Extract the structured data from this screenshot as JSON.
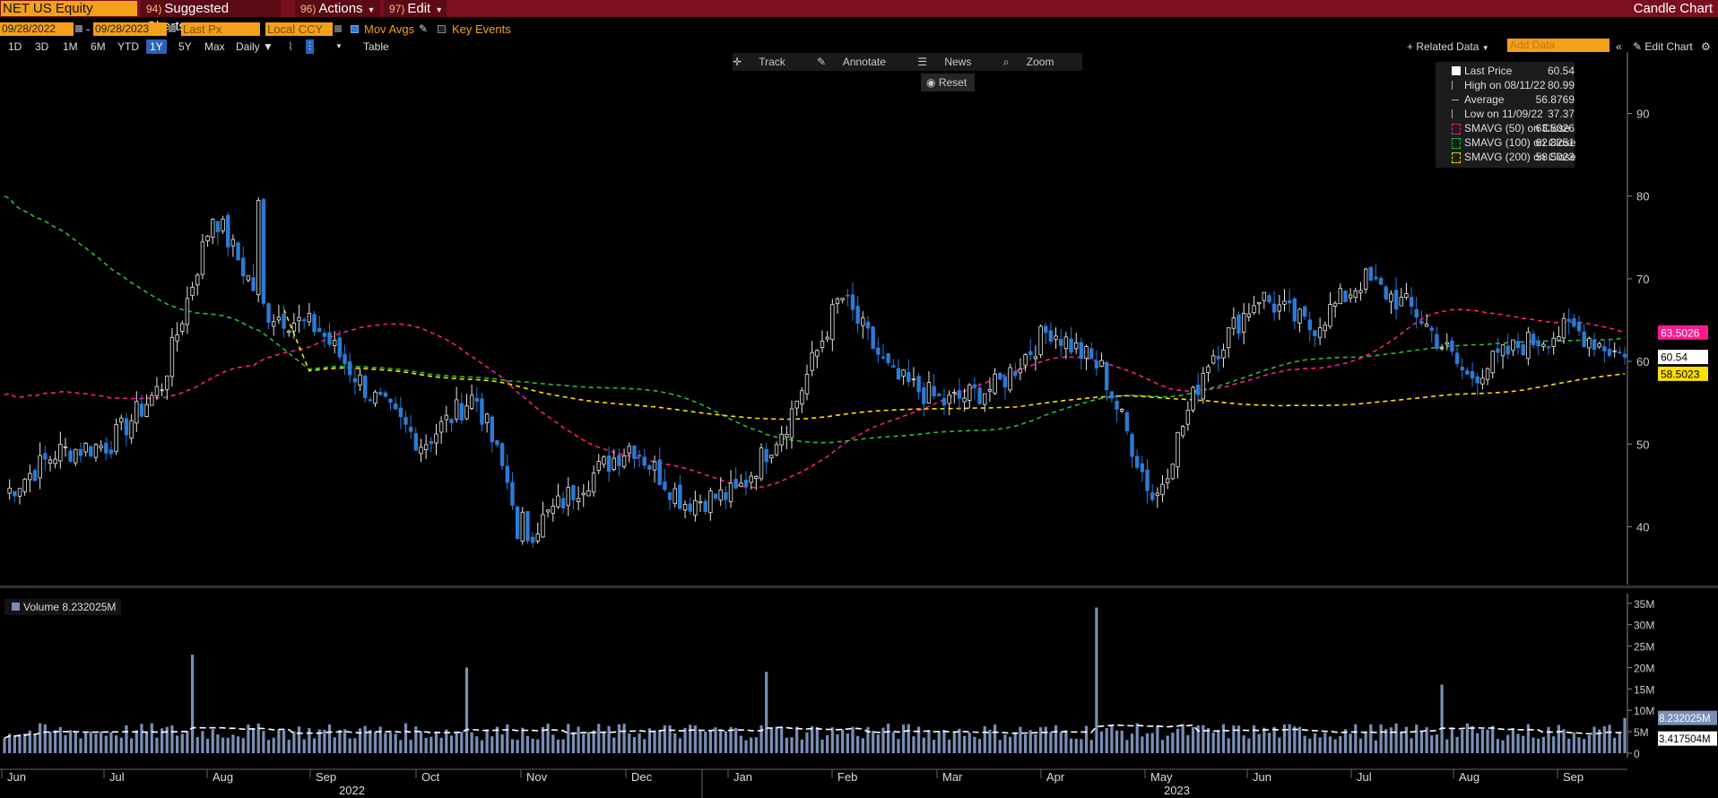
{
  "topbar": {
    "security": "NET US Equity",
    "menus": [
      {
        "num": "94)",
        "label": "Suggested Charts"
      },
      {
        "num": "96)",
        "label": "Actions"
      },
      {
        "num": "97)",
        "label": "Edit"
      }
    ],
    "window_title": "Candle Chart"
  },
  "controls": {
    "start_date": "09/28/2022",
    "date_separator": "-",
    "end_date": "09/28/2023",
    "field": "Last Px",
    "currency": "Local CCY",
    "mov_avgs_label": "Mov Avgs",
    "key_events_label": "Key Events"
  },
  "periods": {
    "items": [
      "1D",
      "3D",
      "1M",
      "6M",
      "YTD",
      "1Y",
      "5Y",
      "Max"
    ],
    "selected": "1Y",
    "frequency": "Daily",
    "table_label": "Table"
  },
  "right_tools": {
    "related_data": "+ Related Data",
    "add_data_placeholder": "Add Data",
    "edit_chart": "Edit Chart"
  },
  "plot_tools": {
    "track": "Track",
    "annotate": "Annotate",
    "news": "News",
    "zoom": "Zoom",
    "reset": "Reset"
  },
  "legend": {
    "rows": [
      {
        "name": "Last Price",
        "value": "60.54",
        "color": "#ffffff"
      },
      {
        "name": "High on 08/11/22",
        "value": "80.99",
        "color": "#aaaaaa"
      },
      {
        "name": "Average",
        "value": "56.8769",
        "color": "#aaaaaa"
      },
      {
        "name": "Low on 11/09/22",
        "value": "37.37",
        "color": "#aaaaaa"
      },
      {
        "name": "SMAVG (50)  on Close",
        "value": "63.5026",
        "color": "#ff1a8c"
      },
      {
        "name": "SMAVG (100)  on Close",
        "value": "62.8251",
        "color": "#1fbf3a"
      },
      {
        "name": "SMAVG (200)  on Close",
        "value": "58.5023",
        "color": "#ffe000"
      }
    ]
  },
  "volume_legend": {
    "label": "Volume",
    "value": "8.232025M"
  },
  "price_tags": [
    {
      "text": "63.5026",
      "value": 63.5026,
      "bg": "#ff1a8c",
      "fg": "#ffffff"
    },
    {
      "text": "60.54",
      "value": 60.54,
      "bg": "#ffffff",
      "fg": "#000000"
    },
    {
      "text": "58.5023",
      "value": 58.5023,
      "bg": "#ffe000",
      "fg": "#000000"
    }
  ],
  "volume_tags": [
    {
      "text": "8.232025M",
      "value": 8.232,
      "bg": "#7a8fb8",
      "fg": "#ffffff"
    },
    {
      "text": "3.417504M",
      "value": 3.4175,
      "bg": "#ffffff",
      "fg": "#000000"
    }
  ],
  "chart_data": {
    "type": "candlestick",
    "x_months": [
      "Jun",
      "Jul",
      "Aug",
      "Sep",
      "Oct",
      "Nov",
      "Dec",
      "Jan",
      "Feb",
      "Mar",
      "Apr",
      "May",
      "Jun",
      "Jul",
      "Aug",
      "Sep"
    ],
    "x_years": [
      "2022",
      "2023"
    ],
    "price_ylim": [
      33,
      97
    ],
    "price_ticks": [
      40,
      50,
      60,
      70,
      80,
      90
    ],
    "volume_ylim": [
      0,
      36
    ],
    "volume_ticks": [
      "0",
      "5M",
      "10M",
      "15M",
      "20M",
      "25M",
      "30M",
      "35M"
    ],
    "price_anchors": [
      {
        "month": "Jun 2022",
        "value": 44
      },
      {
        "month": "mid Jun 2022",
        "value": 49
      },
      {
        "month": "Jul 2022",
        "value": 50
      },
      {
        "month": "mid Jul 2022",
        "value": 57
      },
      {
        "month": "Aug 2022",
        "value": 78
      },
      {
        "month": "mid Aug 2022",
        "value": 66
      },
      {
        "month": "Sep 2022",
        "value": 64
      },
      {
        "month": "mid Sep 2022",
        "value": 56
      },
      {
        "month": "Oct 2022",
        "value": 50
      },
      {
        "month": "mid Oct 2022",
        "value": 56
      },
      {
        "month": "Nov 2022",
        "value": 39
      },
      {
        "month": "mid Nov 2022",
        "value": 45
      },
      {
        "month": "Dec 2022",
        "value": 50
      },
      {
        "month": "mid Dec 2022",
        "value": 43
      },
      {
        "month": "Jan 2023",
        "value": 44
      },
      {
        "month": "mid Jan 2023",
        "value": 53
      },
      {
        "month": "Feb 2023",
        "value": 68
      },
      {
        "month": "mid Feb 2023",
        "value": 58
      },
      {
        "month": "Mar 2023",
        "value": 55
      },
      {
        "month": "mid Mar 2023",
        "value": 57
      },
      {
        "month": "Apr 2023",
        "value": 64
      },
      {
        "month": "end Apr 2023",
        "value": 59
      },
      {
        "month": "May 2023 (gap)",
        "value": 43
      },
      {
        "month": "mid May 2023",
        "value": 60
      },
      {
        "month": "Jun 2023",
        "value": 68
      },
      {
        "month": "mid Jun 2023",
        "value": 64
      },
      {
        "month": "Jul 2023",
        "value": 70
      },
      {
        "month": "mid Jul 2023",
        "value": 66
      },
      {
        "month": "Aug 2023",
        "value": 58
      },
      {
        "month": "mid Aug 2023",
        "value": 62
      },
      {
        "month": "Sep 2023",
        "value": 64
      },
      {
        "month": "end Sep 2023",
        "value": 60.54
      }
    ],
    "high": {
      "date": "08/11/22",
      "value": 80.99
    },
    "low": {
      "date": "11/09/22",
      "value": 37.37
    },
    "average": 56.8769,
    "last": 60.54,
    "moving_averages": [
      {
        "name": "SMAVG (50)",
        "color": "#ff1a8c",
        "last": 63.5026
      },
      {
        "name": "SMAVG (100)",
        "color": "#1fbf3a",
        "last": 62.8251
      },
      {
        "name": "SMAVG (200)",
        "color": "#ffe000",
        "last": 58.5023
      }
    ],
    "up_color": "#e8e8e8",
    "down_color": "#2a7bd6",
    "volume_color": "#7a8fb8",
    "volume_avg_color": "#ffffff",
    "volume_spikes_M": [
      {
        "month": "Aug 2022",
        "value": 23
      },
      {
        "month": "Nov 2022",
        "value": 20
      },
      {
        "month": "Feb 2023",
        "value": 19
      },
      {
        "month": "May 2023",
        "value": 34
      },
      {
        "month": "Aug 2023",
        "value": 16
      },
      {
        "month": "Sep 2023",
        "value": 8.23
      }
    ]
  }
}
